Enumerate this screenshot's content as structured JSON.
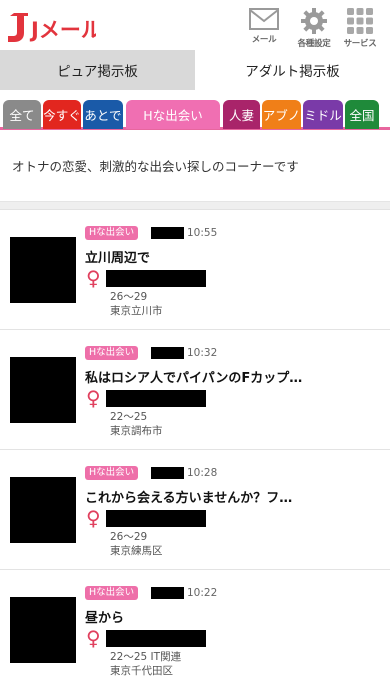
{
  "brand": {
    "logo": "Jメール",
    "color": "#e2343d"
  },
  "header_icons": [
    {
      "label": "メール",
      "icon": "mail-icon"
    },
    {
      "label": "各種設定",
      "icon": "gear-icon"
    },
    {
      "label": "サービス",
      "icon": "grid-icon"
    }
  ],
  "tabs": [
    {
      "label": "ピュア掲示板",
      "active": false
    },
    {
      "label": "アダルト掲示板",
      "active": true
    }
  ],
  "categories": [
    {
      "label": "全て",
      "color": "#8a8a8a"
    },
    {
      "label": "今すぐ",
      "color": "#e2261f"
    },
    {
      "label": "あとで",
      "color": "#1a5aa8"
    },
    {
      "label": "Hな出会い",
      "color": "#f06fb2",
      "selected": true
    },
    {
      "label": "人妻",
      "color": "#a9246a"
    },
    {
      "label": "アブノ",
      "color": "#f07f18"
    },
    {
      "label": "ミドル",
      "color": "#7a3aa8"
    },
    {
      "label": "全国",
      "color": "#1f8a3a"
    }
  ],
  "intro": "オトナの恋愛、刺激的な出会い探しのコーナーです",
  "posts": [
    {
      "badge": "Hな出会い",
      "time": "10:55",
      "title": "立川周辺で",
      "gender": "♀",
      "age": "26～29",
      "area": "東京立川市"
    },
    {
      "badge": "Hな出会い",
      "time": "10:32",
      "title": "私はロシア人でパイパンのFカップ…",
      "gender": "♀",
      "age": "22～25",
      "area": "東京調布市"
    },
    {
      "badge": "Hな出会い",
      "time": "10:28",
      "title": "これから会える方いませんか？フ…",
      "gender": "♀",
      "age": "26～29",
      "area": "東京練馬区"
    },
    {
      "badge": "Hな出会い",
      "time": "10:22",
      "title": "昼から",
      "gender": "♀",
      "age": "22～25 IT関連",
      "area": "東京千代田区"
    }
  ]
}
